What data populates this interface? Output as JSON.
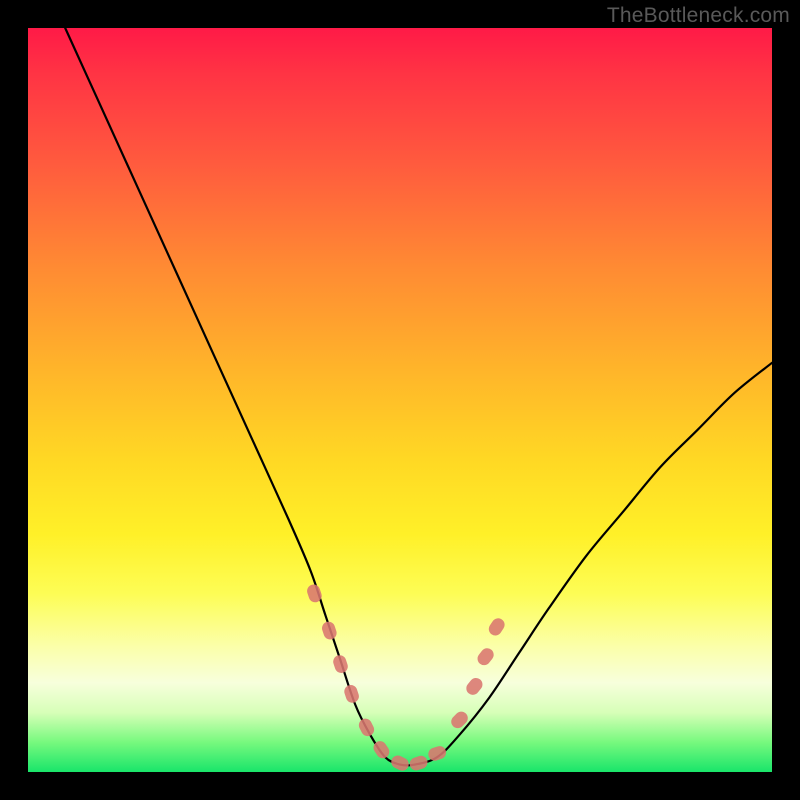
{
  "watermark": {
    "text": "TheBottleneck.com"
  },
  "chart_data": {
    "type": "line",
    "title": "",
    "xlabel": "",
    "ylabel": "",
    "xlim": [
      0,
      100
    ],
    "ylim": [
      0,
      100
    ],
    "grid": false,
    "legend": false,
    "series": [
      {
        "name": "curve",
        "color": "#000000",
        "x": [
          5,
          10,
          15,
          20,
          25,
          30,
          35,
          38,
          40,
          42,
          44,
          46,
          48,
          50,
          52,
          55,
          58,
          62,
          66,
          70,
          75,
          80,
          85,
          90,
          95,
          100
        ],
        "y": [
          100,
          89,
          78,
          67,
          56,
          45,
          34,
          27,
          21,
          15,
          9,
          5,
          2,
          1,
          1,
          2,
          5,
          10,
          16,
          22,
          29,
          35,
          41,
          46,
          51,
          55
        ]
      },
      {
        "name": "markers",
        "color": "#d9766f",
        "type": "scatter",
        "x": [
          38.5,
          40.5,
          42.0,
          43.5,
          45.5,
          47.5,
          50.0,
          52.5,
          55.0,
          58.0,
          60.0,
          61.5,
          63.0
        ],
        "y": [
          24.0,
          19.0,
          14.5,
          10.5,
          6.0,
          3.0,
          1.2,
          1.2,
          2.5,
          7.0,
          11.5,
          15.5,
          19.5
        ]
      }
    ]
  }
}
